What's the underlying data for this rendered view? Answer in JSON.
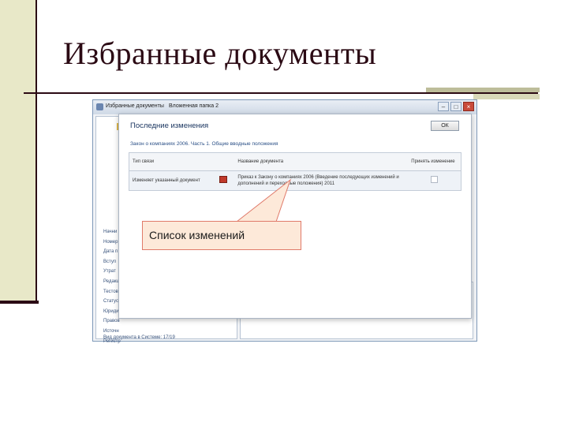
{
  "slide": {
    "title": "Избранные документы"
  },
  "window": {
    "tabs": [
      "Избранные документы",
      "Вложенная папка 2"
    ],
    "controls": [
      "–",
      "□",
      "×"
    ],
    "sidebar_items": [
      "Начни",
      "Номер",
      "Дата п",
      "Вступ",
      "Утрат",
      "Редакц",
      "Тестов",
      "Статус",
      "Юриди",
      "Правов",
      "Источн",
      "Регистр"
    ],
    "sidebar_footer": "Вид документа в Системе: 17/19"
  },
  "dialog": {
    "title": "Последние изменения",
    "ok_label": "ОК",
    "subtitle": "Закон о компаниях 2006. Часть 1. Общие вводные положения",
    "columns": [
      "Тип связи",
      "Название документа",
      "Принять изменение"
    ],
    "rows": [
      {
        "link_type": "Изменяет указанный документ",
        "doc_name": "Приказ к Закону о компаниях 2006 (Введение последующих изменений и дополнений и переходные положения) 2011"
      }
    ]
  },
  "callout": {
    "text": "Список изменений"
  },
  "colors": {
    "title": "#2b0a14",
    "callout_fill": "#fde9d9",
    "callout_border": "#e07a6a",
    "left_bar": "#e8e8c8"
  }
}
